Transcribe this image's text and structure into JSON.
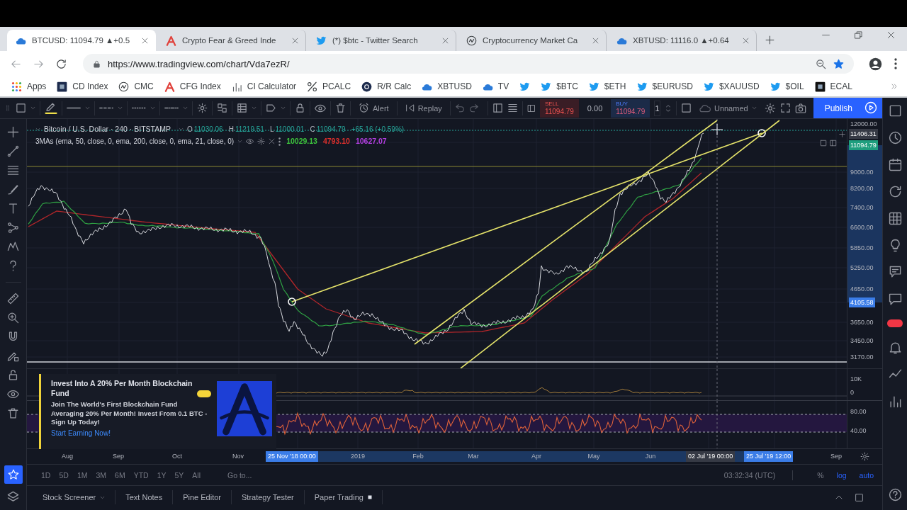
{
  "browser": {
    "tabs": [
      {
        "title": "BTCUSD: 11094.79 ▲+0.5",
        "selected": true
      },
      {
        "title": "Crypto Fear & Greed Inde",
        "selected": false
      },
      {
        "title": "(*) $btc - Twitter Search",
        "selected": false
      },
      {
        "title": "Cryptocurrency Market Ca",
        "selected": false
      },
      {
        "title": "XBTUSD: 11116.0 ▲+0.64",
        "selected": false
      }
    ],
    "address": "https://www.tradingview.com/chart/Vda7ezR/",
    "bookmarks": [
      {
        "kind": "link",
        "label": "Apps"
      },
      {
        "kind": "link",
        "label": "CD Index"
      },
      {
        "kind": "link",
        "label": "CMC"
      },
      {
        "kind": "link",
        "label": "CFG Index"
      },
      {
        "kind": "link",
        "label": "CI Calculator"
      },
      {
        "kind": "link",
        "label": "PCALC"
      },
      {
        "kind": "link",
        "label": "R/R Calc"
      },
      {
        "kind": "link",
        "label": "XBTUSD"
      },
      {
        "kind": "link",
        "label": "TV"
      },
      {
        "kind": "icon"
      },
      {
        "kind": "link",
        "label": "$BTC"
      },
      {
        "kind": "link",
        "label": "$ETH"
      },
      {
        "kind": "link",
        "label": "$EURUSD"
      },
      {
        "kind": "link",
        "label": "$XAUUSD"
      },
      {
        "kind": "link",
        "label": "$OIL"
      },
      {
        "kind": "link",
        "label": "ECAL"
      }
    ]
  },
  "chart_toolbar": {
    "alert": "Alert",
    "replay": "Replay",
    "sell": {
      "label": "SELL",
      "price": "11094.79"
    },
    "spread": "0.00",
    "buy": {
      "label": "BUY",
      "price": "11094.79"
    },
    "quantity": "1",
    "layout_name": "Unnamed",
    "publish": "Publish"
  },
  "legend": {
    "symbol": "Bitcoin / U.S. Dollar · 240 · BITSTAMP",
    "ohlc": [
      {
        "label": "O",
        "value": "11030.06"
      },
      {
        "label": "H",
        "value": "11219.51"
      },
      {
        "label": "L",
        "value": "11000.01"
      },
      {
        "label": "C",
        "value": "11094.79"
      }
    ],
    "change": "+65.16 (+0.59%)",
    "study": "3MAs (ema, 50, close, 0, ema, 200, close, 0, ema, 21, close, 0)",
    "study_values": [
      {
        "value": "10029.13",
        "color": "#3cc23c"
      },
      {
        "value": "4793.10",
        "color": "#e0302c"
      },
      {
        "value": "10627.07",
        "color": "#b23fe0"
      }
    ]
  },
  "price_axis": [
    {
      "text": "12000.00",
      "kind": "tick"
    },
    {
      "text": "11406.31",
      "kind": "crosshair"
    },
    {
      "text": "11094.79",
      "kind": "last"
    },
    {
      "text": "9000.00",
      "kind": "tick"
    },
    {
      "text": "8200.00",
      "kind": "tick"
    },
    {
      "text": "7400.00",
      "kind": "tick"
    },
    {
      "text": "6600.00",
      "kind": "tick"
    },
    {
      "text": "5850.00",
      "kind": "tick"
    },
    {
      "text": "5250.00",
      "kind": "tick"
    },
    {
      "text": "4650.00",
      "kind": "tick"
    },
    {
      "text": "4105.58",
      "kind": "selection"
    },
    {
      "text": "3650.00",
      "kind": "tick"
    },
    {
      "text": "3450.00",
      "kind": "tick"
    },
    {
      "text": "3170.00",
      "kind": "tick"
    }
  ],
  "volume_axis": [
    "10K",
    "0"
  ],
  "rsi_axis": [
    "80.00",
    "40.00"
  ],
  "ad": {
    "title": "Invest Into A 20% Per Month Blockchain Fund",
    "body": "Join The World's First Blockchain Fund Averaging 20% Per Month! Invest From 0.1 BTC - Sign Up Today!",
    "link": "Start Earning Now!"
  },
  "time_axis": [
    {
      "text": "Aug",
      "kind": "tick"
    },
    {
      "text": "Sep",
      "kind": "tick"
    },
    {
      "text": "Oct",
      "kind": "tick"
    },
    {
      "text": "Nov",
      "kind": "tick"
    },
    {
      "text": "25 Nov '18 00:00",
      "kind": "selection"
    },
    {
      "text": "2019",
      "kind": "tick"
    },
    {
      "text": "Feb",
      "kind": "tick"
    },
    {
      "text": "Mar",
      "kind": "tick"
    },
    {
      "text": "Apr",
      "kind": "tick"
    },
    {
      "text": "May",
      "kind": "tick"
    },
    {
      "text": "Jun",
      "kind": "tick"
    },
    {
      "text": "02 Jul '19 00:00",
      "kind": "crosshair"
    },
    {
      "text": "25 Jul '19 12:00",
      "kind": "selection"
    },
    {
      "text": "Sep",
      "kind": "tick"
    }
  ],
  "range_bar": {
    "periods": [
      "1D",
      "5D",
      "1M",
      "3M",
      "6M",
      "YTD",
      "1Y",
      "5Y",
      "All"
    ],
    "go_to": "Go to...",
    "clock": "03:32:34 (UTC)",
    "scale_options": [
      {
        "label": "%",
        "selected": false
      },
      {
        "label": "log",
        "selected": true
      },
      {
        "label": "auto",
        "selected": true
      }
    ]
  },
  "bottom_tabs": [
    {
      "label": "Stock Screener",
      "kind": "dropdown"
    },
    {
      "label": "Text Notes",
      "kind": "plain"
    },
    {
      "label": "Pine Editor",
      "kind": "plain"
    },
    {
      "label": "Strategy Tester",
      "kind": "plain"
    },
    {
      "label": "Paper Trading",
      "kind": "status"
    }
  ]
}
